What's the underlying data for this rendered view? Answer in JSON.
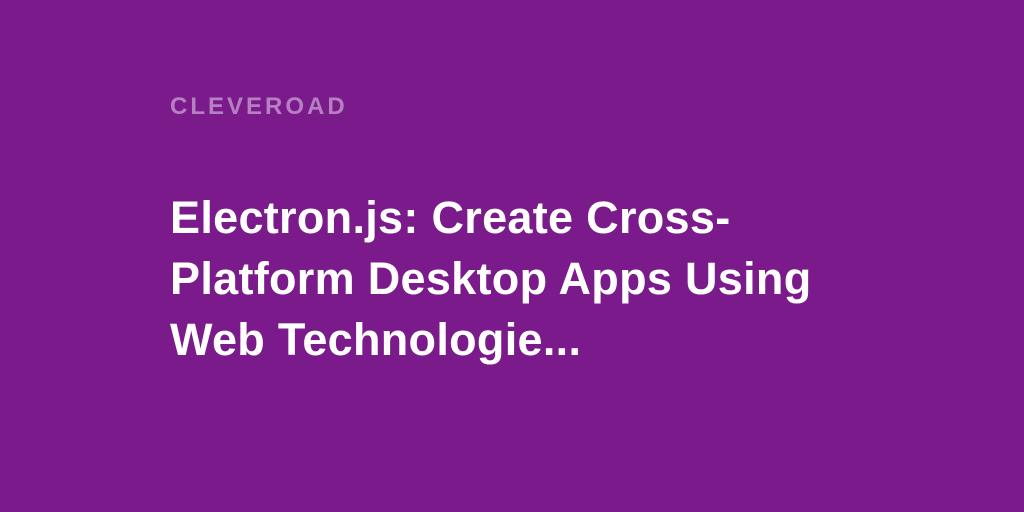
{
  "brand": "CLEVEROAD",
  "title": "Electron.js: Create Cross-Platform Desktop Apps Using Web Technologie...",
  "colors": {
    "background": "#7B1B8B",
    "brand_text": "#B57FC2",
    "title_text": "#FFFFFF"
  }
}
